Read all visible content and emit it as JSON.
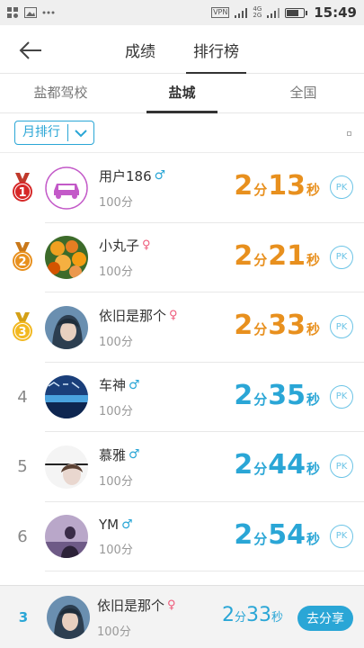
{
  "status": {
    "vpn": "VPN",
    "net_top": "4G",
    "net_bottom": "2G",
    "time": "15:49"
  },
  "header": {
    "tabs": [
      {
        "label": "成绩"
      },
      {
        "label": "排行榜"
      }
    ],
    "active_tab": "排行榜",
    "back_icon": "arrow-left-icon"
  },
  "sub_tabs": [
    {
      "label": "盐都驾校"
    },
    {
      "label": "盐城"
    },
    {
      "label": "全国"
    }
  ],
  "active_sub_tab": "盐城",
  "filter": {
    "label": "月排行"
  },
  "colors": {
    "accent": "#2aa6d6",
    "orange": "#e8901e",
    "female": "#ee5a7a",
    "gold": "#f2b820",
    "red": "#d62828"
  },
  "rows": [
    {
      "rank": "1",
      "name": "用户186",
      "gender": "♂",
      "score": "100分",
      "min": "2",
      "min_unit": "分",
      "sec": "13",
      "sec_unit": "秒",
      "pk": "PK"
    },
    {
      "rank": "2",
      "name": "小丸子",
      "gender": "♀",
      "score": "100分",
      "min": "2",
      "min_unit": "分",
      "sec": "21",
      "sec_unit": "秒",
      "pk": "PK"
    },
    {
      "rank": "3",
      "name": "依旧是那个",
      "gender": "♀",
      "score": "100分",
      "min": "2",
      "min_unit": "分",
      "sec": "33",
      "sec_unit": "秒",
      "pk": "PK"
    },
    {
      "rank": "4",
      "name": "车神",
      "gender": "♂",
      "score": "100分",
      "min": "2",
      "min_unit": "分",
      "sec": "35",
      "sec_unit": "秒",
      "pk": "PK"
    },
    {
      "rank": "5",
      "name": "慕雅",
      "gender": "♂",
      "score": "100分",
      "min": "2",
      "min_unit": "分",
      "sec": "44",
      "sec_unit": "秒",
      "pk": "PK"
    },
    {
      "rank": "6",
      "name": "YM",
      "gender": "♂",
      "score": "100分",
      "min": "2",
      "min_unit": "分",
      "sec": "54",
      "sec_unit": "秒",
      "pk": "PK"
    }
  ],
  "my_rank": {
    "rank": "3",
    "name": "依旧是那个",
    "gender": "♀",
    "score": "100分",
    "min": "2",
    "min_unit": "分",
    "sec": "33",
    "sec_unit": "秒",
    "share": "去分享"
  }
}
